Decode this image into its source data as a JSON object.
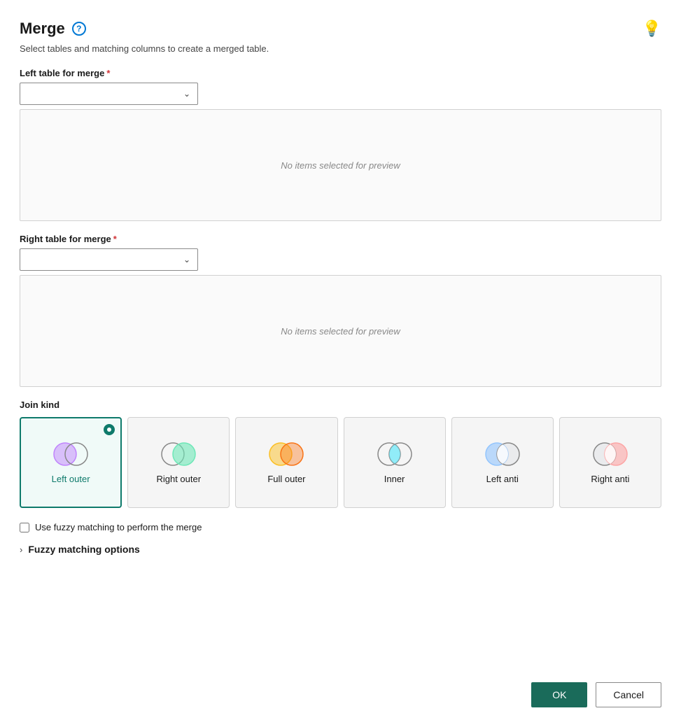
{
  "dialog": {
    "title": "Merge",
    "subtitle": "Select tables and matching columns to create a merged table.",
    "help_icon_label": "?",
    "lightbulb_icon_label": "💡"
  },
  "left_table": {
    "label": "Left table for merge",
    "required": true,
    "placeholder": "",
    "preview_text": "No items selected for preview"
  },
  "right_table": {
    "label": "Right table for merge",
    "required": true,
    "placeholder": "",
    "preview_text": "No items selected for preview"
  },
  "join_kind": {
    "label": "Join kind",
    "options": [
      {
        "id": "left-outer",
        "label": "Left outer",
        "selected": true
      },
      {
        "id": "right-outer",
        "label": "Right outer",
        "selected": false
      },
      {
        "id": "full-outer",
        "label": "Full outer",
        "selected": false
      },
      {
        "id": "inner",
        "label": "Inner",
        "selected": false
      },
      {
        "id": "left-anti",
        "label": "Left anti",
        "selected": false
      },
      {
        "id": "right-anti",
        "label": "Right anti",
        "selected": false
      }
    ]
  },
  "fuzzy": {
    "checkbox_label": "Use fuzzy matching to perform the merge",
    "options_label": "Fuzzy matching options"
  },
  "buttons": {
    "ok": "OK",
    "cancel": "Cancel"
  }
}
